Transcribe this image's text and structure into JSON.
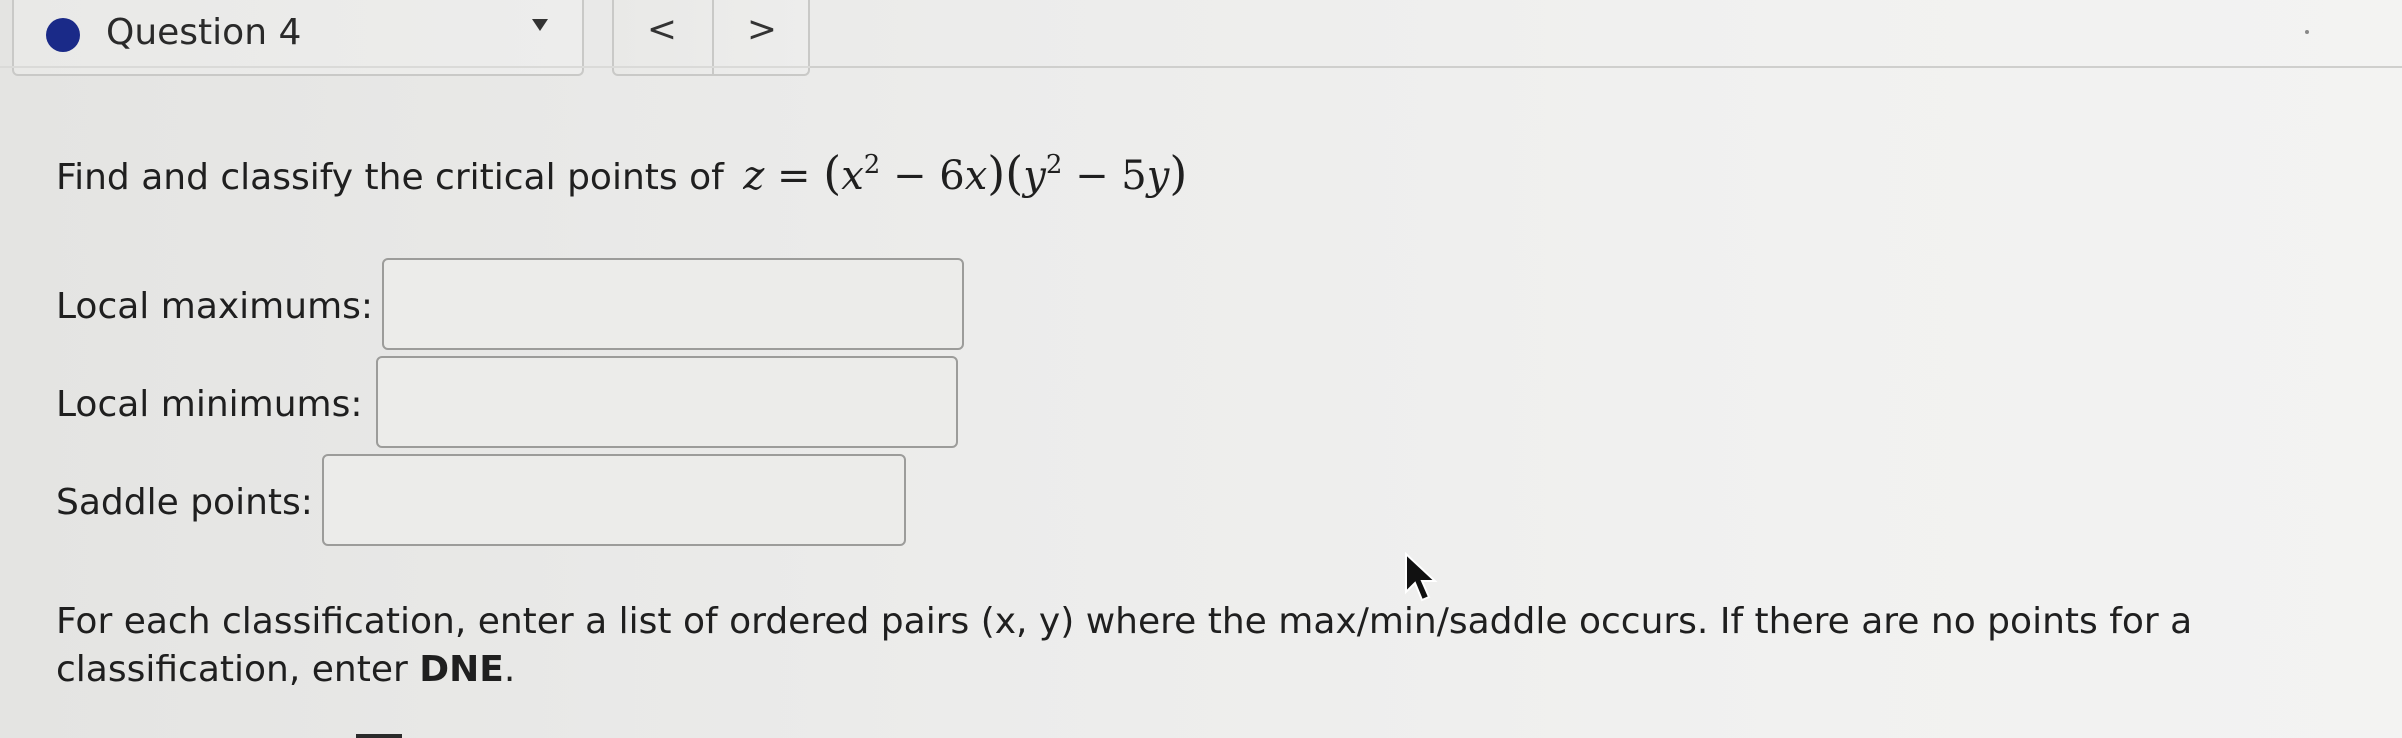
{
  "header": {
    "question_label": "Question 4",
    "prev_label": "<",
    "next_label": ">",
    "status_color": "#1a2a88"
  },
  "question": {
    "prompt": "Find and classify the critical points of",
    "formula_display": "z = (x² − 6x)(y² − 5y)"
  },
  "fields": {
    "local_max_label": "Local maximums:",
    "local_max_value": "",
    "local_min_label": "Local minimums:",
    "local_min_value": "",
    "saddle_label": "Saddle points:",
    "saddle_value": ""
  },
  "instructions": {
    "text_before": "For each classification, enter a list of ordered pairs (x, y) where the max/min/saddle occurs. If there are no points for a classification, enter ",
    "text_bold": "DNE",
    "text_after": "."
  },
  "icons": {
    "status": "status-dot-icon",
    "dropdown": "caret-down-icon",
    "cursor": "mouse-pointer-icon"
  }
}
